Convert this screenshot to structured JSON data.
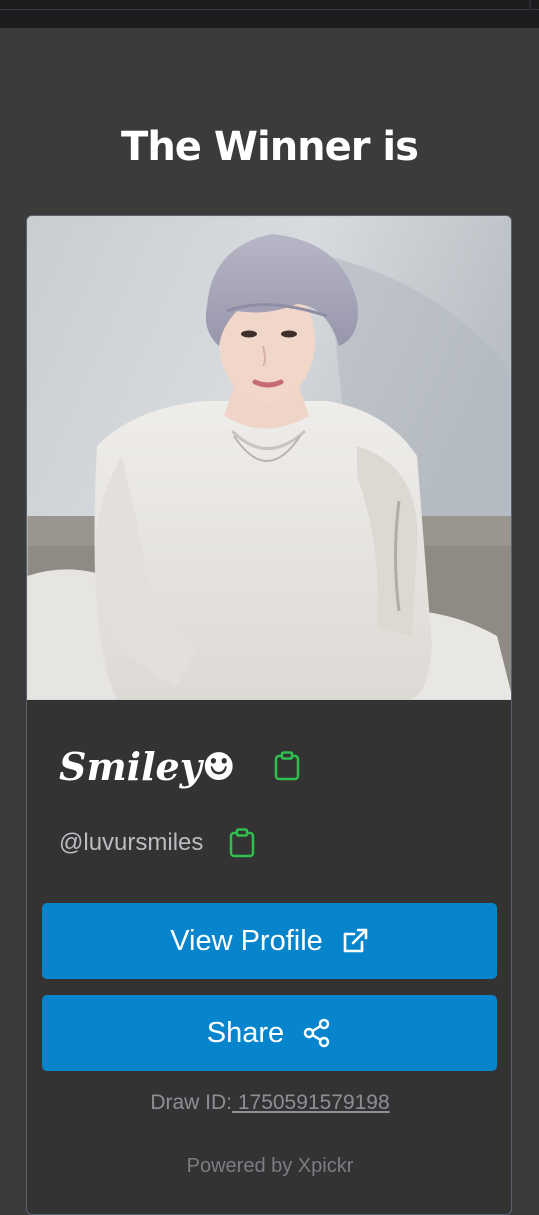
{
  "header": {
    "title": "The Winner is"
  },
  "winner": {
    "display_name": "𝑺𝒎𝒊𝒍𝒆𝒚☻",
    "handle": "@luvursmiles",
    "photo_icon": "profile-photo"
  },
  "actions": {
    "view_profile_label": "View Profile",
    "view_profile_icon": "external-link-icon",
    "share_label": "Share",
    "share_icon": "share-icon",
    "copy_icon": "clipboard-icon"
  },
  "footer": {
    "draw_id_label": "Draw ID:",
    "draw_id_value": " 1750591579198",
    "powered_by": "Powered by Xpickr"
  },
  "colors": {
    "background": "#3b3b3b",
    "card": "#333333",
    "button": "#0785cc",
    "copy_icon": "#2fbf4f"
  }
}
